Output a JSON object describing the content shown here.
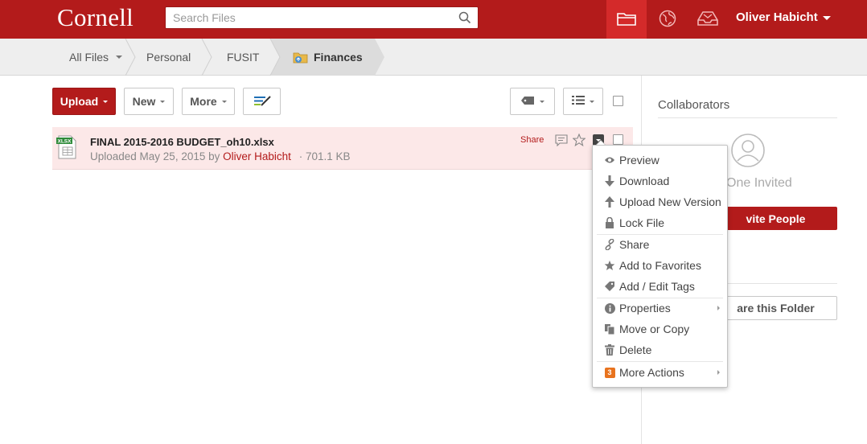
{
  "header": {
    "logo": "Cornell",
    "search_placeholder": "Search Files",
    "user_name": "Oliver Habicht"
  },
  "breadcrumb": {
    "items": [
      "All Files",
      "Personal",
      "FUSIT",
      "Finances"
    ]
  },
  "toolbar": {
    "upload_label": "Upload",
    "new_label": "New",
    "more_label": "More"
  },
  "file": {
    "name": "FINAL 2015-2016 BUDGET_oh10.xlsx",
    "uploaded_prefix": "Uploaded May 25, 2015 by",
    "owner": "Oliver Habicht",
    "size_sep": "·",
    "size": "701.1 KB",
    "share_label": "Share",
    "icon_label": "XLSX"
  },
  "sidebar": {
    "collaborators_title": "Collaborators",
    "one_invited": "One Invited",
    "invite_label": "vite People",
    "share_folder_label": "are this Folder"
  },
  "menu": {
    "items": [
      {
        "label": "Preview",
        "icon": "eye-icon"
      },
      {
        "label": "Download",
        "icon": "download-arrow-icon"
      },
      {
        "label": "Upload New Version",
        "icon": "upload-arrow-icon"
      },
      {
        "label": "Lock File",
        "icon": "lock-icon"
      },
      {
        "label": "Share",
        "icon": "link-icon"
      },
      {
        "label": "Add to Favorites",
        "icon": "star-icon"
      },
      {
        "label": "Add / Edit Tags",
        "icon": "tag-icon"
      },
      {
        "label": "Properties",
        "icon": "info-icon"
      },
      {
        "label": "Move or Copy",
        "icon": "copy-icon"
      },
      {
        "label": "Delete",
        "icon": "trash-icon"
      },
      {
        "label": "More Actions",
        "icon": "badge-icon",
        "badge": "3"
      }
    ]
  },
  "colors": {
    "brand": "#b31b1b",
    "header_active": "#d42a2a",
    "row_highlight": "#fce8e8",
    "badge": "#e8731e"
  }
}
